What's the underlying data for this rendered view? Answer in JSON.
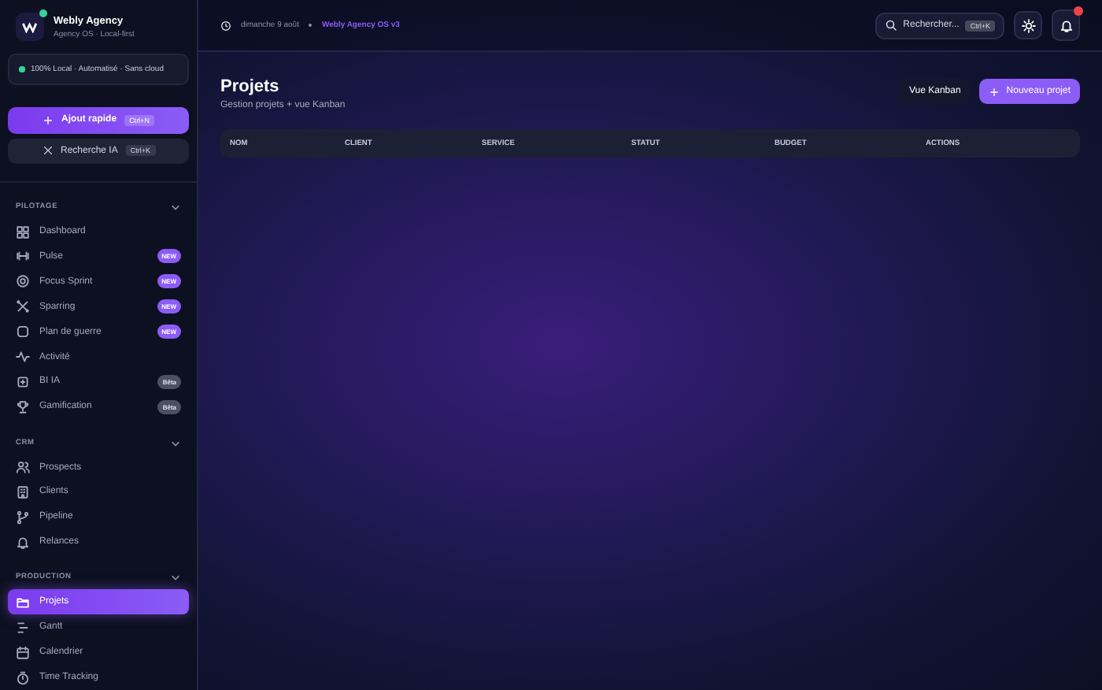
{
  "brand": {
    "name": "Webly Agency",
    "subtitle": "Agency OS · Local-first",
    "status": "100% Local · Automatisé · Sans cloud"
  },
  "quick_actions": [
    {
      "label": "Ajout rapide",
      "shortcut": "Ctrl+N",
      "kind": "primary"
    },
    {
      "label": "Recherche IA",
      "shortcut": "Ctrl+K",
      "kind": "secondary"
    }
  ],
  "sidebar": {
    "sections": [
      {
        "title": "PILOTAGE",
        "expanded": true,
        "items": [
          {
            "label": "Dashboard",
            "selected": false
          },
          {
            "label": "Pulse",
            "selected": false,
            "badge": "NEW",
            "kind": "new"
          },
          {
            "label": "Focus Sprint",
            "selected": false,
            "badge": "NEW",
            "kind": "new"
          },
          {
            "label": "Sparring",
            "selected": false,
            "badge": "NEW",
            "kind": "new"
          },
          {
            "label": "Plan de guerre",
            "selected": false,
            "badge": "NEW",
            "kind": "new"
          },
          {
            "label": "Activité",
            "selected": false
          },
          {
            "label": "BI IA",
            "selected": false,
            "badge": "Bêta",
            "kind": "beta"
          },
          {
            "label": "Gamification",
            "selected": false,
            "badge": "Bêta",
            "kind": "beta"
          }
        ]
      },
      {
        "title": "CRM",
        "expanded": true,
        "items": [
          {
            "label": "Prospects",
            "selected": false
          },
          {
            "label": "Clients",
            "selected": false
          },
          {
            "label": "Pipeline",
            "selected": false
          },
          {
            "label": "Relances",
            "selected": false
          }
        ]
      },
      {
        "title": "PRODUCTION",
        "expanded": true,
        "items": [
          {
            "label": "Projets",
            "selected": true
          },
          {
            "label": "Gantt",
            "selected": false
          },
          {
            "label": "Calendrier",
            "selected": false
          },
          {
            "label": "Time Tracking",
            "selected": false
          }
        ]
      }
    ]
  },
  "top_bar": {
    "date": "dimanche 9 août",
    "version": "Webly Agency OS v3",
    "search": {
      "placeholder": "Rechercher...",
      "shortcut": "Ctrl+K"
    },
    "notifications_unread": true
  },
  "page": {
    "title": "Projets",
    "subtitle": "Gestion projets + vue Kanban",
    "buttons": [
      {
        "label": "Vue Kanban",
        "kind": "secondary"
      },
      {
        "label": "Nouveau projet",
        "kind": "primary"
      }
    ]
  },
  "table": {
    "columns": [
      "NOM",
      "CLIENT",
      "SERVICE",
      "STATUT",
      "BUDGET",
      "ACTIONS"
    ]
  }
}
